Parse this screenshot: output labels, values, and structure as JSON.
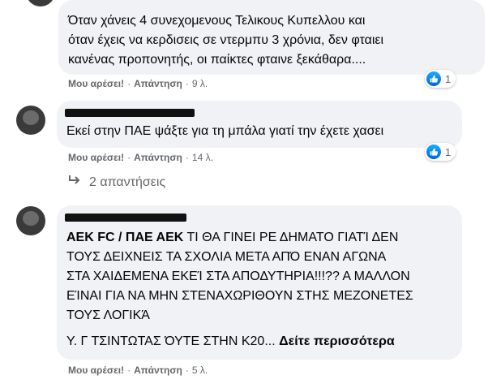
{
  "comment1": {
    "lines": [
      "Όταν χάνεις 4 συνεχομενους Τελικους Κυπελλου και",
      "όταν έχεις να κερδισεις σε ντερμπυ 3 χρόνια, δεν φταιει",
      "κανένας προπονητής, οι παίκτες φταινε ξεκάθαρα...."
    ],
    "like_label": "Μου αρέσει!",
    "reply_label": "Απάντηση",
    "time": "9 λ.",
    "reaction_count": "1"
  },
  "comment2": {
    "text": "Εκεί στην ΠΑΕ ψάξτε για τη μπάλα γιατί την έχετε χασει",
    "like_label": "Μου αρέσει!",
    "reply_label": "Απάντηση",
    "time": "14 λ.",
    "reaction_count": "1",
    "replies_label": "2 απαντήσεις"
  },
  "comment3": {
    "tag": "ΑΕΚ FC / ΠΑΕ ΑΕΚ",
    "first_line_rest": " ΤΙ ΘΑ ΓΙΝΕΙ ΡΕ ΔΗΜΑΤΟ ΓΙΑΤΊ ΔΕΝ",
    "lines": [
      "ΤΟΥΣ ΔΕΙΧΝΕΙΣ ΤΑ ΣΧΟΛΙΑ ΜΕΤΑ ΑΠΌ ΕΝΑΝ ΑΓΩΝΑ",
      "ΣΤΑ ΧΑΙΔΕΜΕΝΑ ΕΚΕΊ ΣΤΑ ΑΠΟΔΥΤΗΡΙΑ!!!?? Α ΜΑΛΛΟΝ",
      "ΕΊΝΑΙ ΓΙΑ ΝΑ ΜΗΝ ΣΤΕΝΑΧΩΡΙΘΟΥΝ ΣΤΗΣ ΜΕΖΟΝΕΤΕΣ",
      "ΤΟΥΣ ΛΟΓΙΚΆ"
    ],
    "truncated_line": "Υ. Γ ΤΣΙΝΤΩΤΑΣ ΌΥΤΕ ΣΤΗΝ Κ20...",
    "see_more": "Δείτε περισσότερα",
    "like_label": "Μου αρέσει!",
    "reply_label": "Απάντηση",
    "time": "5 λ."
  },
  "colors": {
    "bubble": "#f0f2f5",
    "meta": "#65676b",
    "like_blue": "#1877f2"
  },
  "icons": {
    "like": "thumbs-up-icon",
    "reply_arrow": "reply-arrow-icon"
  }
}
